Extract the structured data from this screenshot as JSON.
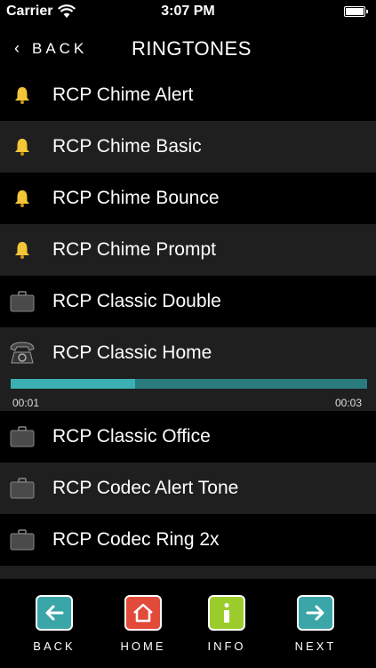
{
  "status": {
    "carrier": "Carrier",
    "time": "3:07 PM"
  },
  "nav": {
    "back_label": "BACK",
    "title": "RINGTONES"
  },
  "ringtones": [
    {
      "label": "RCP Chime Alert",
      "icon": "bell-icon"
    },
    {
      "label": "RCP Chime Basic",
      "icon": "bell-icon"
    },
    {
      "label": "RCP Chime Bounce",
      "icon": "bell-icon"
    },
    {
      "label": "RCP Chime Prompt",
      "icon": "bell-icon"
    },
    {
      "label": "RCP Classic Double",
      "icon": "briefcase-icon"
    },
    {
      "label": "RCP Classic Home",
      "icon": "phone-icon"
    },
    {
      "label": "RCP Classic Office",
      "icon": "briefcase-icon"
    },
    {
      "label": "RCP Codec Alert Tone",
      "icon": "briefcase-icon"
    },
    {
      "label": "RCP Codec Ring 2x",
      "icon": "briefcase-icon"
    }
  ],
  "player": {
    "elapsed": "00:01",
    "duration": "00:03",
    "progress_fraction": 0.35
  },
  "toolbar": {
    "back_label": "BACK",
    "home_label": "HOME",
    "info_label": "INFO",
    "next_label": "NEXT"
  },
  "colors": {
    "back_button": "#3aa6a8",
    "home_button": "#e24a3a",
    "info_button": "#9ccc2c",
    "next_button": "#3aa6a8",
    "progress_fill": "#3bb0b3",
    "progress_track": "#2a7b7e"
  }
}
